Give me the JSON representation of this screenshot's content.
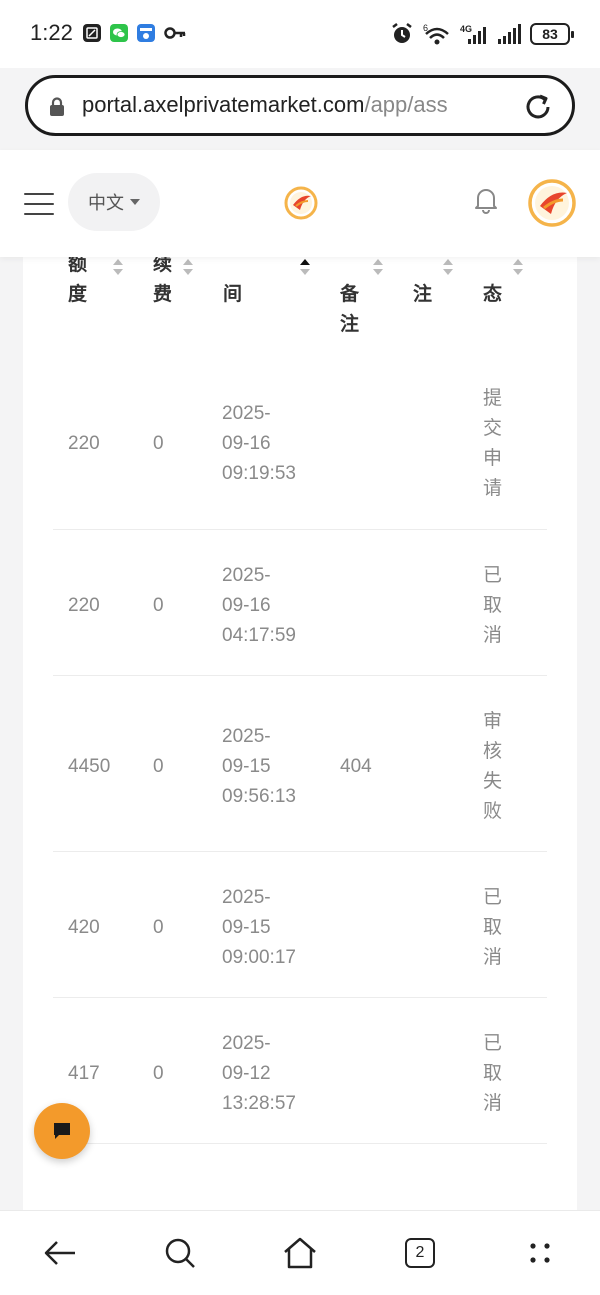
{
  "status_bar": {
    "time": "1:22",
    "battery": "83",
    "network": "4G",
    "wifi_label": "6"
  },
  "browser": {
    "url_host": "portal.axelprivatemarket.com",
    "url_path": "/app/ass"
  },
  "header": {
    "language": "中文"
  },
  "table": {
    "headers": [
      [
        "额",
        "度"
      ],
      [
        "续",
        "费"
      ],
      [
        "间"
      ],
      [
        "备",
        "注"
      ],
      [
        "注"
      ],
      [
        "态"
      ]
    ],
    "rows": [
      {
        "amount": "220",
        "fee": "0",
        "date": "2025-",
        "date2": "09-16",
        "time": "09:19:53",
        "remark": "",
        "status": [
          "提",
          "交",
          "申",
          "请"
        ]
      },
      {
        "amount": "220",
        "fee": "0",
        "date": "2025-",
        "date2": "09-16",
        "time": "04:17:59",
        "remark": "",
        "status": [
          "已",
          "取",
          "消"
        ]
      },
      {
        "amount": "4450",
        "fee": "0",
        "date": "2025-",
        "date2": "09-15",
        "time": "09:56:13",
        "remark": "404",
        "status": [
          "审",
          "核",
          "失",
          "败"
        ]
      },
      {
        "amount": "420",
        "fee": "0",
        "date": "2025-",
        "date2": "09-15",
        "time": "09:00:17",
        "remark": "",
        "status": [
          "已",
          "取",
          "消"
        ]
      },
      {
        "amount": "417",
        "fee": "0",
        "date": "2025-",
        "date2": "09-12",
        "time": "13:28:57",
        "remark": "",
        "status": [
          "已",
          "取",
          "消"
        ]
      }
    ]
  },
  "nav": {
    "tabs_count": "2"
  },
  "colors": {
    "accent": "#f39a2b",
    "logo_red": "#e8452c",
    "text_muted": "#8a8a8a"
  }
}
